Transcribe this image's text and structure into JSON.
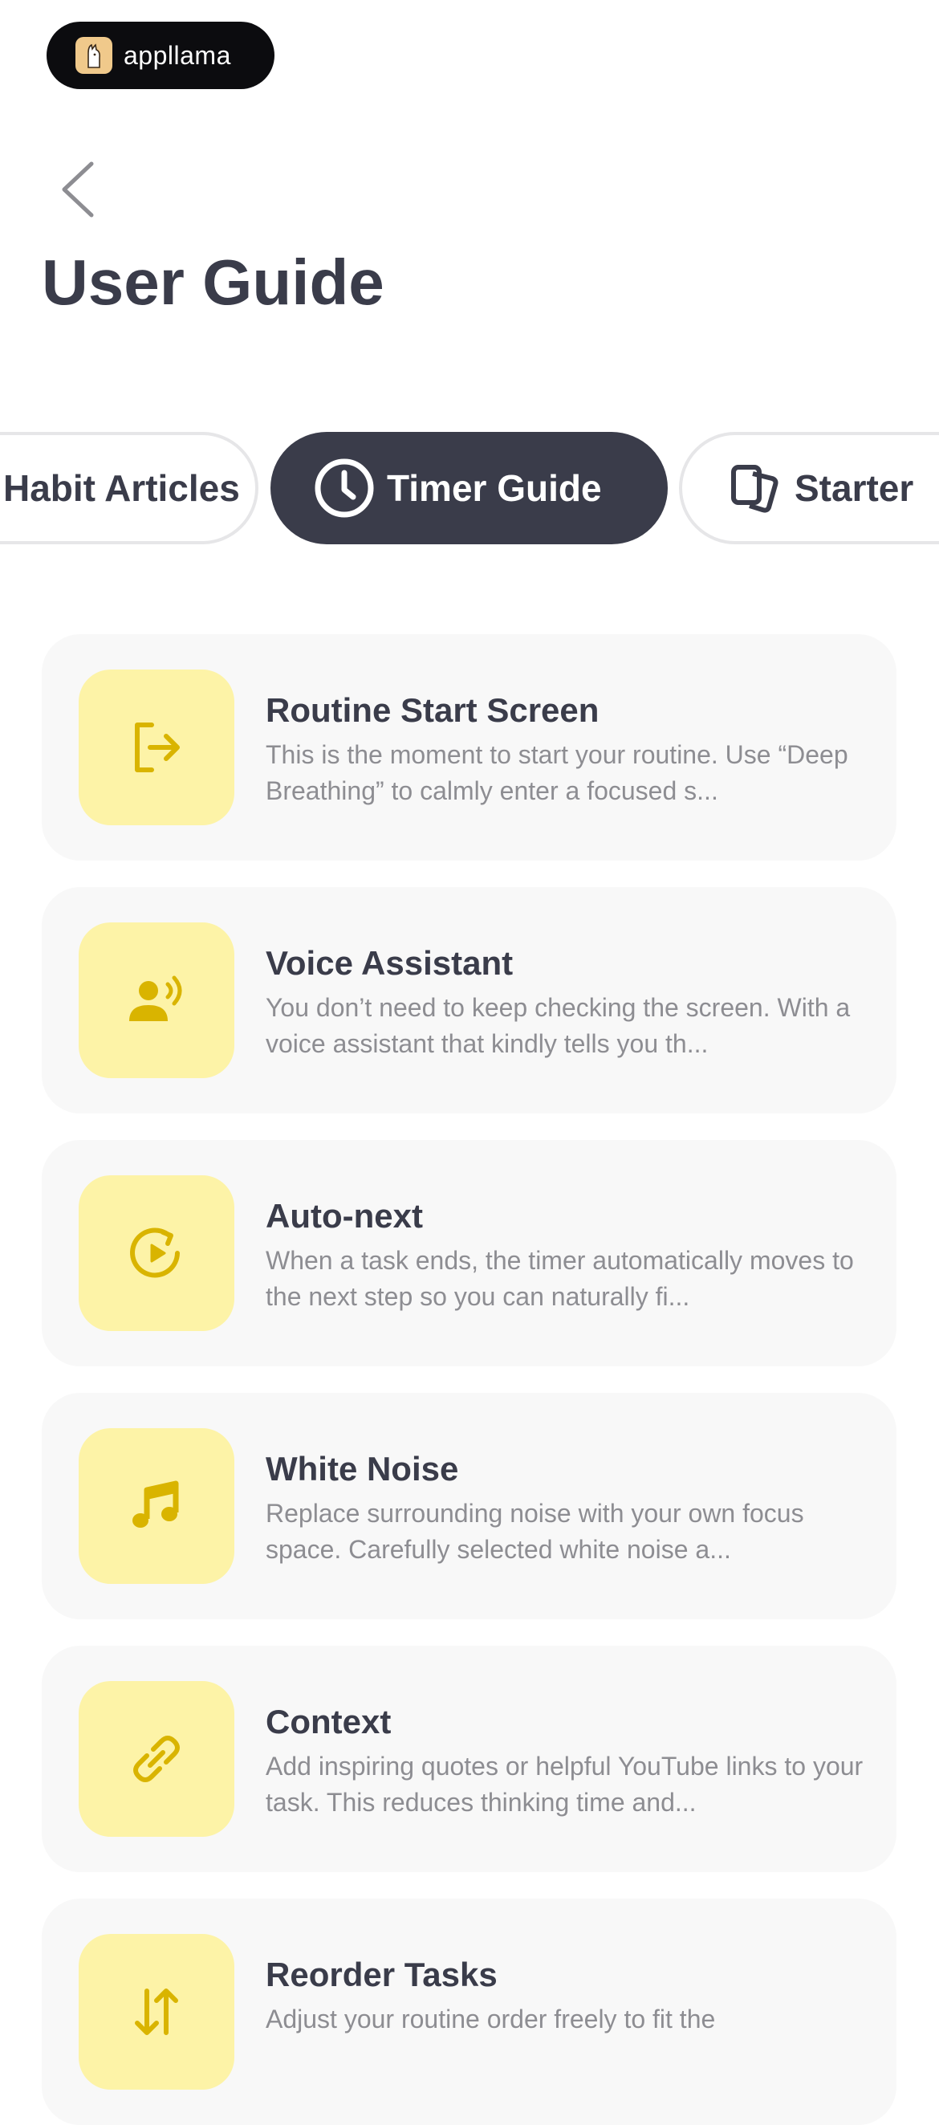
{
  "brand": {
    "name": "appllama",
    "logo_icon": "llama-icon"
  },
  "header": {
    "back_icon": "chevron-left-icon",
    "title": "User Guide"
  },
  "tabs": [
    {
      "label": "Habit Articles",
      "active": false
    },
    {
      "label": "Timer Guide",
      "icon": "clock-icon",
      "active": true
    },
    {
      "label": "Starter",
      "icon": "cards-icon",
      "active": false
    }
  ],
  "cards": [
    {
      "title": "Routine Start Screen",
      "desc": "This is the moment to start your routine. Use “Deep Breathing” to calmly enter a focused s...",
      "icon": "login-arrow-icon"
    },
    {
      "title": "Voice Assistant",
      "desc": "You don’t need to keep checking the screen. With a voice assistant that kindly tells you th...",
      "icon": "voice-icon"
    },
    {
      "title": "Auto-next",
      "desc": "When a task ends, the timer automatically moves to the next step so you can naturally fi...",
      "icon": "auto-next-icon"
    },
    {
      "title": "White Noise",
      "desc": "Replace surrounding noise with your own focus space. Carefully selected white noise a...",
      "icon": "music-note-icon"
    },
    {
      "title": "Context",
      "desc": "Add inspiring quotes or helpful YouTube links to your task. This reduces thinking time and...",
      "icon": "link-icon"
    },
    {
      "title": "Reorder Tasks",
      "desc": "Adjust your routine order freely to fit the",
      "icon": "reorder-icon"
    }
  ],
  "colors": {
    "accent": "#d9b400",
    "icon_bg": "#fdf3a7",
    "dark": "#3a3c4a",
    "card_bg": "#f8f8f8"
  }
}
